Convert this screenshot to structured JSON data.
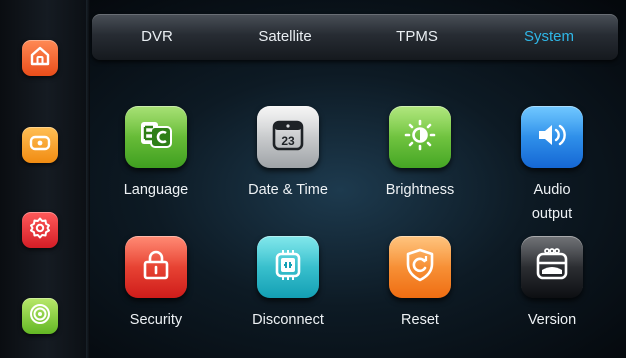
{
  "tabs": {
    "items": [
      {
        "label": "DVR"
      },
      {
        "label": "Satellite"
      },
      {
        "label": "TPMS"
      },
      {
        "label": "System",
        "active": true
      }
    ]
  },
  "sidebar": {
    "items": [
      {
        "icon": "home-icon",
        "color": "#ea4d1a"
      },
      {
        "icon": "media-icon",
        "color": "#f18c12"
      },
      {
        "icon": "settings-icon",
        "color": "#d41d26"
      },
      {
        "icon": "radar-icon",
        "color": "#63b724"
      }
    ]
  },
  "grid": {
    "items": [
      {
        "label": "Language",
        "icon": "language-icon",
        "color": "#3f9f20"
      },
      {
        "label": "Date & Time",
        "icon": "calendar-icon",
        "color": "#9fa3a7",
        "icon_text": "23"
      },
      {
        "label": "Brightness",
        "icon": "brightness-icon",
        "color": "#45a624"
      },
      {
        "label": "Audio",
        "label2": "output",
        "icon": "speaker-icon",
        "color": "#1567d4"
      },
      {
        "label": "Security",
        "icon": "lock-icon",
        "color": "#cf1c1a"
      },
      {
        "label": "Disconnect",
        "icon": "disconnect-icon",
        "color": "#139fb4"
      },
      {
        "label": "Reset",
        "icon": "reset-icon",
        "color": "#ef6d12"
      },
      {
        "label": "Version",
        "icon": "version-icon",
        "color": "#0d0f12"
      }
    ]
  },
  "accent_color": "#2fb6e6"
}
